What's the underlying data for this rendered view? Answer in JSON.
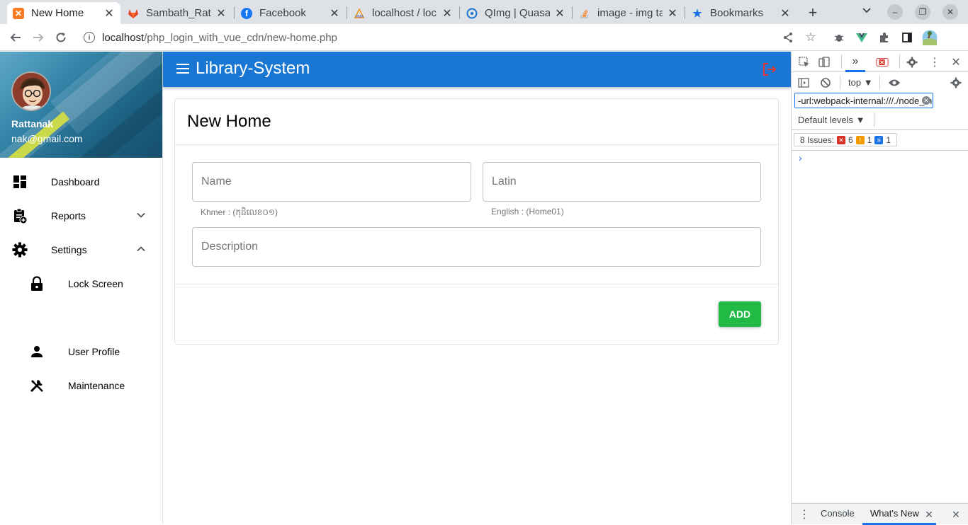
{
  "browser": {
    "tabs": [
      {
        "title": "New Home",
        "icon": "xampp-icon",
        "color": "#fb7a24"
      },
      {
        "title": "Sambath_Ratt",
        "icon": "gitlab-icon",
        "color": "#e24329"
      },
      {
        "title": "Facebook",
        "icon": "facebook-icon",
        "color": "#1877f2"
      },
      {
        "title": "localhost / loc",
        "icon": "phpmyadmin-icon",
        "color": "#f29111"
      },
      {
        "title": "QImg | Quasa",
        "icon": "quasar-icon",
        "color": "#1976d2"
      },
      {
        "title": "image - img ta",
        "icon": "stackoverflow-icon",
        "color": "#f48024"
      },
      {
        "title": "Bookmarks",
        "icon": "star-icon",
        "color": "#1a73e8"
      }
    ],
    "url_host": "localhost",
    "url_path": "/php_login_with_vue_cdn/new-home.php"
  },
  "sidebar": {
    "user_name": "Rattanak",
    "user_email": "nak@gmail.com",
    "items": [
      {
        "label": "Dashboard"
      },
      {
        "label": "Reports"
      },
      {
        "label": "Settings"
      },
      {
        "label": "Lock Screen"
      },
      {
        "label": "User Profile"
      },
      {
        "label": "Maintenance"
      }
    ]
  },
  "appbar": {
    "title": "Library-System",
    "color": "#1976d2"
  },
  "form": {
    "title": "New Home",
    "name_placeholder": "Name",
    "name_hint": "Khmer : (កុដិលេខ០១)",
    "latin_placeholder": "Latin",
    "latin_hint": "English : (Home01)",
    "description_placeholder": "Description",
    "add_label": "ADD",
    "add_color": "#21ba45"
  },
  "devtools": {
    "context": "top",
    "filter_text": "-url:webpack-internal:///./node_modules",
    "levels": "Default levels",
    "issues_label": "8 Issues:",
    "errors": "6",
    "warnings": "1",
    "info": "1",
    "prompt": "›",
    "drawer_tabs": [
      "Console",
      "What's New"
    ]
  }
}
